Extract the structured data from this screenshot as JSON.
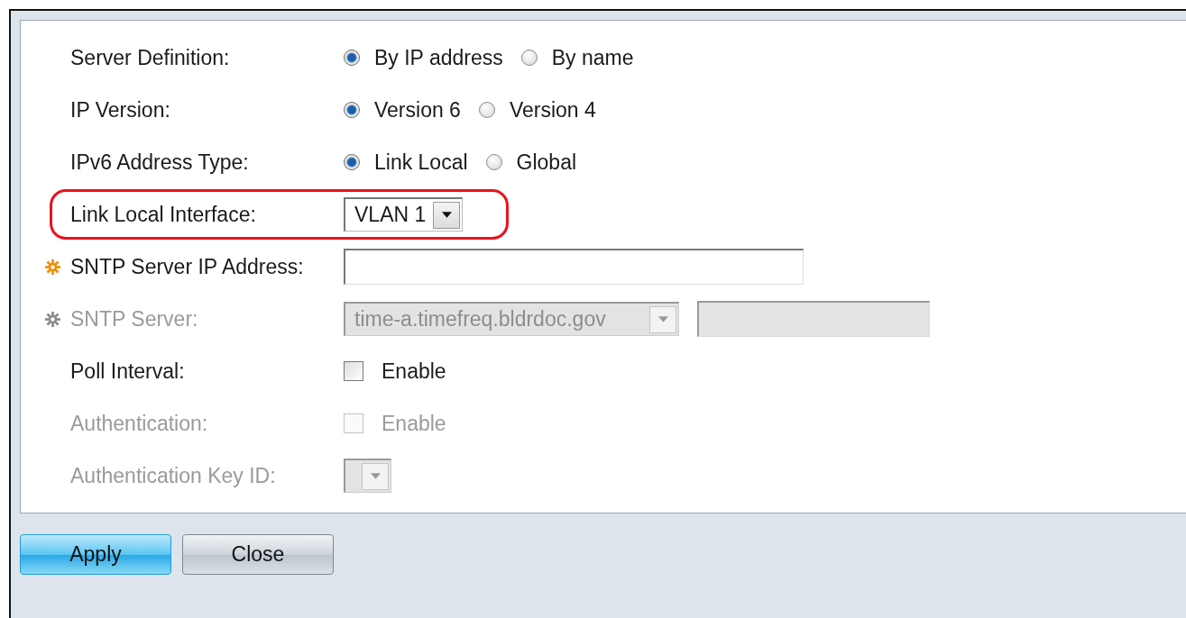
{
  "form": {
    "rows": [
      {
        "kind": "radio",
        "label": "Server Definition:",
        "disabled": false,
        "required": false,
        "highlighted": false,
        "options": [
          {
            "label": "By IP address",
            "selected": true
          },
          {
            "label": "By name",
            "selected": false
          }
        ]
      },
      {
        "kind": "radio",
        "label": "IP Version:",
        "disabled": false,
        "required": false,
        "highlighted": false,
        "options": [
          {
            "label": "Version 6",
            "selected": true
          },
          {
            "label": "Version 4",
            "selected": false
          }
        ]
      },
      {
        "kind": "radio",
        "label": "IPv6 Address Type:",
        "disabled": false,
        "required": false,
        "highlighted": false,
        "options": [
          {
            "label": "Link Local",
            "selected": true
          },
          {
            "label": "Global",
            "selected": false
          }
        ]
      },
      {
        "kind": "select",
        "label": "Link Local Interface:",
        "disabled": false,
        "required": false,
        "highlighted": true,
        "value": "VLAN 1"
      },
      {
        "kind": "text",
        "label": "SNTP Server IP Address:",
        "disabled": false,
        "required": true,
        "highlighted": false
      },
      {
        "kind": "select_text",
        "label": "SNTP Server:",
        "disabled": true,
        "required": true,
        "highlighted": false,
        "value": "time-a.timefreq.bldrdoc.gov"
      },
      {
        "kind": "checkbox",
        "label": "Poll Interval:",
        "disabled": false,
        "required": false,
        "highlighted": false,
        "option": "Enable",
        "checked": false
      },
      {
        "kind": "checkbox",
        "label": "Authentication:",
        "disabled": true,
        "required": false,
        "highlighted": false,
        "option": "Enable",
        "checked": false
      },
      {
        "kind": "select",
        "label": "Authentication Key ID:",
        "disabled": true,
        "required": false,
        "highlighted": false
      }
    ]
  },
  "buttons": [
    {
      "label": "Apply",
      "kind": "primary"
    },
    {
      "label": "Close",
      "kind": "secondary"
    }
  ]
}
